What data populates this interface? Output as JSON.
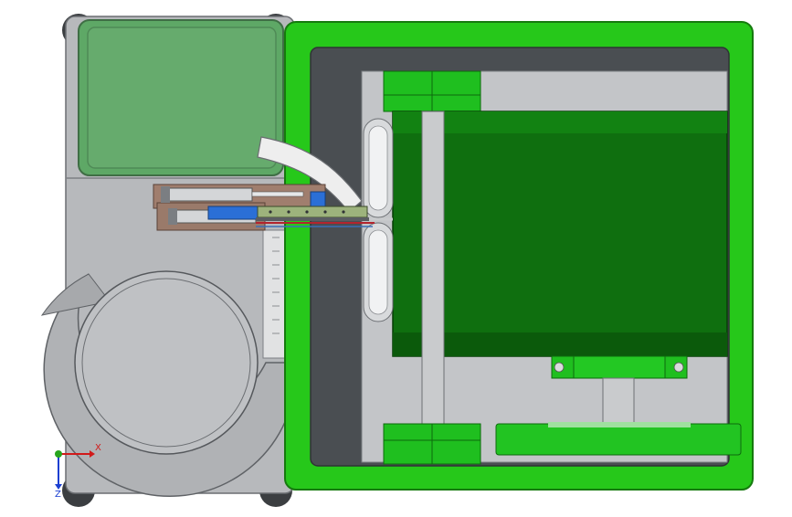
{
  "viewport": {
    "background": "#ffffff"
  },
  "model": {
    "colors": {
      "frame_green": "#26c81a",
      "frame_green_dark": "#1b8a12",
      "motor_green": "#0f6f0f",
      "motor_green_dark": "#0a4d0a",
      "block_green": "#21c021",
      "inner_gray": "#4a4e52",
      "panel_gray": "#c3c5c8",
      "body_gray": "#b9bbbe",
      "hopper_green": "#5ea866",
      "rod_gray": "#c9cbcd",
      "bracket_brown": "#9a7a6a",
      "blue_part": "#2b6fd6"
    },
    "parts": [
      "left-housing",
      "green-hopper",
      "feed-bowl",
      "green-frame",
      "motor",
      "vertical-shaft",
      "pulley-discs",
      "cylinder-assembly",
      "bottom-belt-pulley"
    ]
  },
  "triad": {
    "x_label": "X",
    "z_label": "Z",
    "x_color": "#d11a1a",
    "y_color": "#27a51e",
    "z_color": "#1a3fd1"
  }
}
